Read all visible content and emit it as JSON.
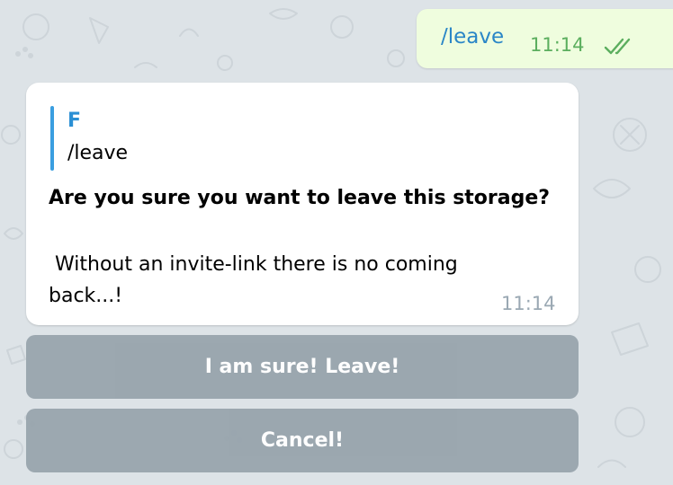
{
  "chat": {
    "outgoing": {
      "text": "/leave",
      "time": "11:14",
      "status_icon": "double-check-icon"
    },
    "incoming": {
      "reply_sender": "F",
      "reply_text": "/leave",
      "heading": "Are you sure you want to leave this storage?",
      "body": " Without an invite-link there is no coming back...!",
      "time": "11:14"
    },
    "keyboard": {
      "buttons": [
        {
          "label": "I am sure! Leave!"
        },
        {
          "label": "Cancel!"
        }
      ]
    }
  },
  "colors": {
    "wallpaper": "#dde3e7",
    "outgoing_bubble": "#effdde",
    "incoming_bubble": "#ffffff",
    "accent": "#2a8fd4",
    "keyboard_button": "#98a4ad"
  }
}
